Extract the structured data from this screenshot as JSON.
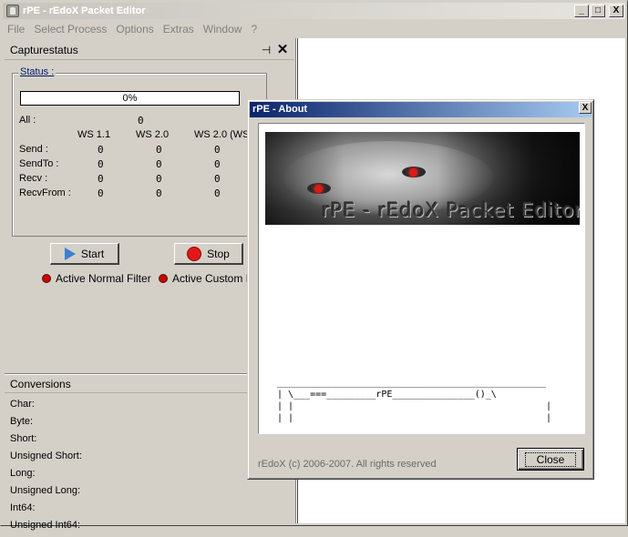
{
  "window": {
    "title": "rPE - rEdoX Packet Editor",
    "caption_min": "_",
    "caption_max": "□",
    "caption_close": "X"
  },
  "menu": [
    "File",
    "Select Process",
    "Options",
    "Extras",
    "Window",
    "?"
  ],
  "capture_panel": {
    "title": "Capturestatus",
    "pin_glyph": "⊣",
    "close_glyph": "✕",
    "status_label": "Status :",
    "progress": "0%",
    "all_label": "All :",
    "all_value": "0",
    "columns": [
      "WS 1.1",
      "WS 2.0",
      "WS 2.0 (WS"
    ],
    "rows": [
      {
        "label": "Send :",
        "values": [
          "0",
          "0",
          "0"
        ]
      },
      {
        "label": "SendTo :",
        "values": [
          "0",
          "0",
          "0"
        ]
      },
      {
        "label": "Recv :",
        "values": [
          "0",
          "0",
          "0"
        ]
      },
      {
        "label": "RecvFrom :",
        "values": [
          "0",
          "0",
          "0"
        ]
      }
    ],
    "start_label": "Start",
    "stop_label": "Stop",
    "filter_normal": "Active Normal Filter",
    "filter_custom": "Active Custom Fil"
  },
  "conversions": {
    "title": "Conversions",
    "items": [
      "Char:",
      "Byte:",
      "Short:",
      "Unsigned Short:",
      "Long:",
      "Unsigned Long:",
      "Int64:",
      "Unsigned Int64:"
    ]
  },
  "about": {
    "title": "rPE - About",
    "close_glyph": "X",
    "banner_text": "rPE - rEdoX Packet Editor",
    "ascii_art": "_________________________________________________\n| \\___===_________rPE_______________()_\\\n| |                                              |\n| |                                              |",
    "copyright": "rEdoX (c) 2006-2007. All rights reserved",
    "close_button": "Close"
  }
}
